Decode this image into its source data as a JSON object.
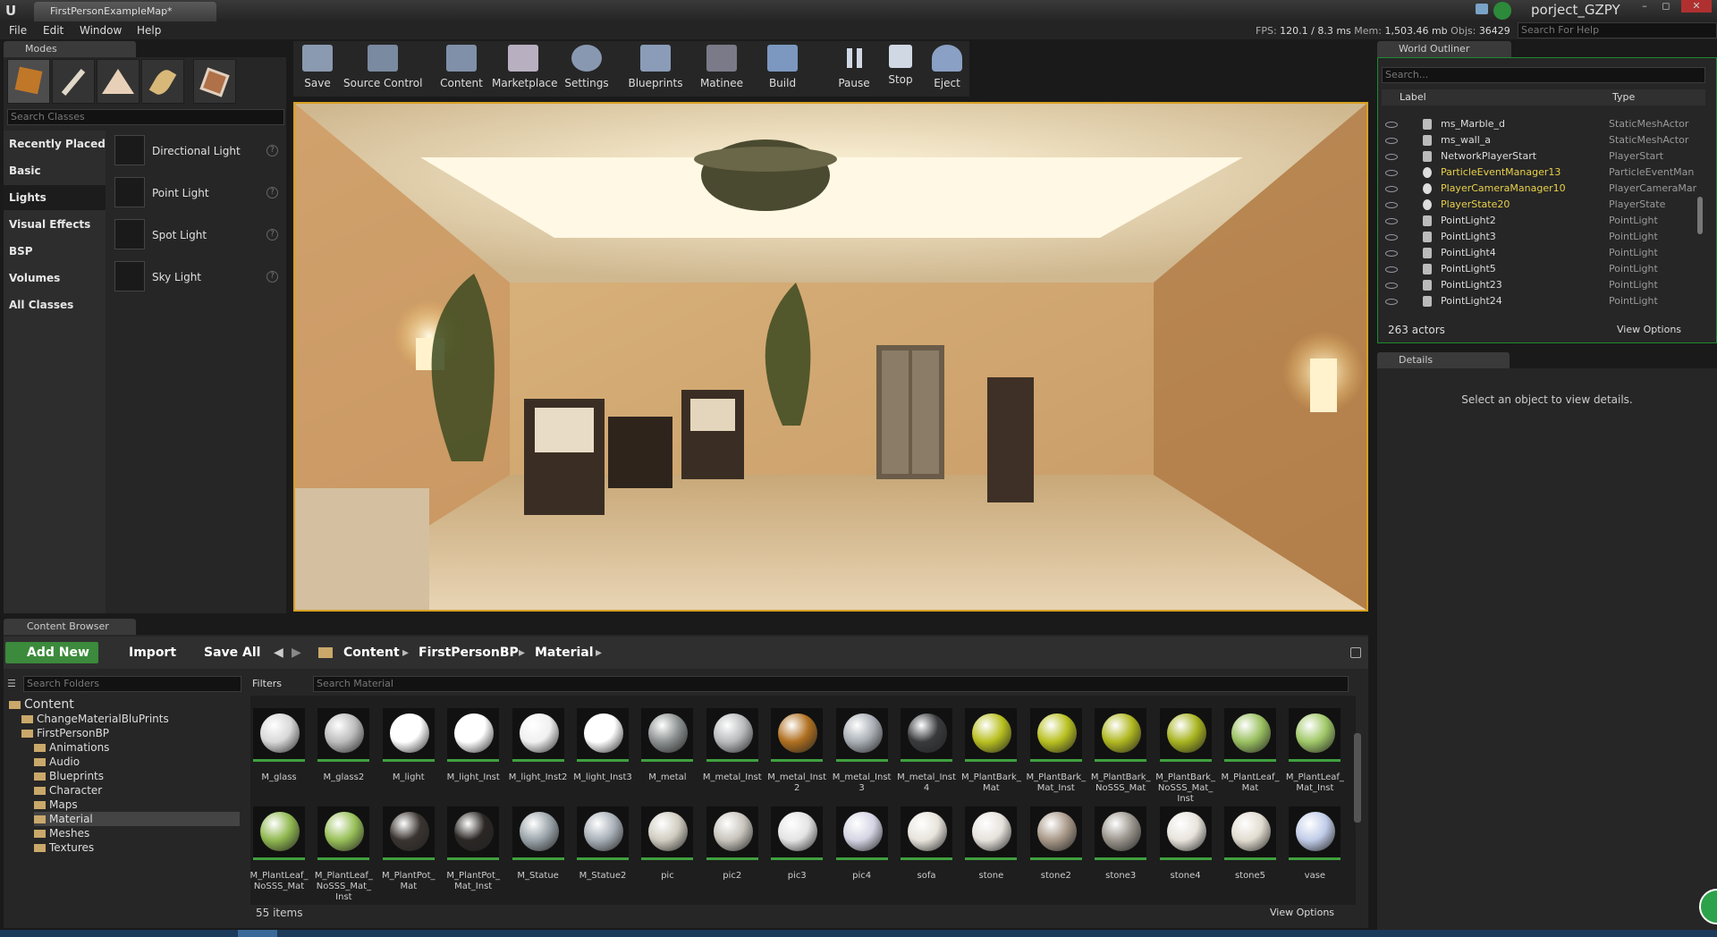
{
  "app": {
    "map_tab": "FirstPersonExampleMap*",
    "project_name": "porject_GZPY",
    "window_buttons": [
      "–",
      "◻",
      "✕"
    ]
  },
  "menu": [
    "File",
    "Edit",
    "Window",
    "Help"
  ],
  "perf": {
    "fps_label": "FPS:",
    "fps_value": "120.1 / 8.3 ms",
    "mem_label": "Mem:",
    "mem_value": "1,503.46 mb",
    "objs_label": "Objs:",
    "objs_value": "36429"
  },
  "help_search_placeholder": "Search For Help",
  "modes": {
    "tab": "Modes",
    "search_placeholder": "Search Classes",
    "categories": [
      "Recently Placed",
      "Basic",
      "Lights",
      "Visual Effects",
      "BSP",
      "Volumes",
      "All Classes"
    ],
    "active_category": "Lights",
    "items": [
      "Directional Light",
      "Point Light",
      "Spot Light",
      "Sky Light"
    ]
  },
  "toolbar": [
    "Save",
    "Source Control",
    "Content",
    "Marketplace",
    "Settings",
    "Blueprints",
    "Matinee",
    "Build",
    "Pause",
    "Stop",
    "Eject"
  ],
  "world_outliner": {
    "tab": "World Outliner",
    "search_placeholder": "Search...",
    "col_label": "Label",
    "col_type": "Type",
    "rows": [
      {
        "name": "ms_Marble_d",
        "type": "StaticMeshActor",
        "highlight": false
      },
      {
        "name": "ms_wall_a",
        "type": "StaticMeshActor",
        "highlight": false
      },
      {
        "name": "NetworkPlayerStart",
        "type": "PlayerStart",
        "highlight": false
      },
      {
        "name": "ParticleEventManager13",
        "type": "ParticleEventMan",
        "highlight": true
      },
      {
        "name": "PlayerCameraManager10",
        "type": "PlayerCameraMar",
        "highlight": true
      },
      {
        "name": "PlayerState20",
        "type": "PlayerState",
        "highlight": true
      },
      {
        "name": "PointLight2",
        "type": "PointLight",
        "highlight": false
      },
      {
        "name": "PointLight3",
        "type": "PointLight",
        "highlight": false
      },
      {
        "name": "PointLight4",
        "type": "PointLight",
        "highlight": false
      },
      {
        "name": "PointLight5",
        "type": "PointLight",
        "highlight": false
      },
      {
        "name": "PointLight23",
        "type": "PointLight",
        "highlight": false
      },
      {
        "name": "PointLight24",
        "type": "PointLight",
        "highlight": false
      }
    ],
    "count": "263 actors",
    "view_options": "View Options"
  },
  "details": {
    "tab": "Details",
    "message": "Select an object to view details."
  },
  "content_browser": {
    "tab": "Content Browser",
    "add_new": "Add New",
    "import": "Import",
    "save_all": "Save All",
    "breadcrumbs": [
      "Content",
      "FirstPersonBP",
      "Material"
    ],
    "search_folders_placeholder": "Search Folders",
    "folders": [
      {
        "name": "Content",
        "level": 0,
        "selected": false
      },
      {
        "name": "ChangeMaterialBluPrints",
        "level": 1,
        "selected": false
      },
      {
        "name": "FirstPersonBP",
        "level": 1,
        "selected": false
      },
      {
        "name": "Animations",
        "level": 2,
        "selected": false
      },
      {
        "name": "Audio",
        "level": 2,
        "selected": false
      },
      {
        "name": "Blueprints",
        "level": 2,
        "selected": false
      },
      {
        "name": "Character",
        "level": 2,
        "selected": false
      },
      {
        "name": "Maps",
        "level": 2,
        "selected": false
      },
      {
        "name": "Material",
        "level": 2,
        "selected": true
      },
      {
        "name": "Meshes",
        "level": 2,
        "selected": false
      },
      {
        "name": "Textures",
        "level": 2,
        "selected": false
      }
    ],
    "filters": "Filters",
    "search_placeholder": "Search Material",
    "assets_row1": [
      "M_glass",
      "M_glass2",
      "M_light",
      "M_light_Inst",
      "M_light_Inst2",
      "M_light_Inst3",
      "M_metal",
      "M_metal_Inst",
      "M_metal_Inst 2",
      "M_metal_Inst 3",
      "M_metal_Inst 4",
      "M_PlantBark_ Mat",
      "M_PlantBark_ Mat_Inst",
      "M_PlantBark_ NoSSS_Mat",
      "M_PlantBark_ NoSSS_Mat_ Inst",
      "M_PlantLeaf_ Mat",
      "M_PlantLeaf_ Mat_Inst"
    ],
    "assets_row2": [
      "M_PlantLeaf_ NoSSS_Mat",
      "M_PlantLeaf_ NoSSS_Mat_ Inst",
      "M_PlantPot_ Mat",
      "M_PlantPot_ Mat_Inst",
      "M_Statue",
      "M_Statue2",
      "pic",
      "pic2",
      "pic3",
      "pic4",
      "sofa",
      "stone",
      "stone2",
      "stone3",
      "stone4",
      "stone5",
      "vase"
    ],
    "row1_colors": [
      "#d8d8d8",
      "#bcbcbc",
      "#ffffff",
      "#ffffff",
      "#f0f0f0",
      "#ffffff",
      "#8c9090",
      "#b8babc",
      "#b07020",
      "#a8aeb4",
      "#383a3c",
      "#b8c020",
      "#b8c020",
      "#b0b820",
      "#a8b420",
      "#9ac060",
      "#a0c868"
    ],
    "row2_colors": [
      "#90b850",
      "#98c058",
      "#3a3430",
      "#2a2624",
      "#9aa4aa",
      "#a8b0b8",
      "#d0ccc0",
      "#c8c4bc",
      "#e4e4e4",
      "#d4d4e4",
      "#e8e4dc",
      "#e6e2dc",
      "#a89888",
      "#9a948c",
      "#e8e4dc",
      "#e2dcd0",
      "#c0cce8"
    ],
    "count": "55 items",
    "view_options": "View Options"
  }
}
